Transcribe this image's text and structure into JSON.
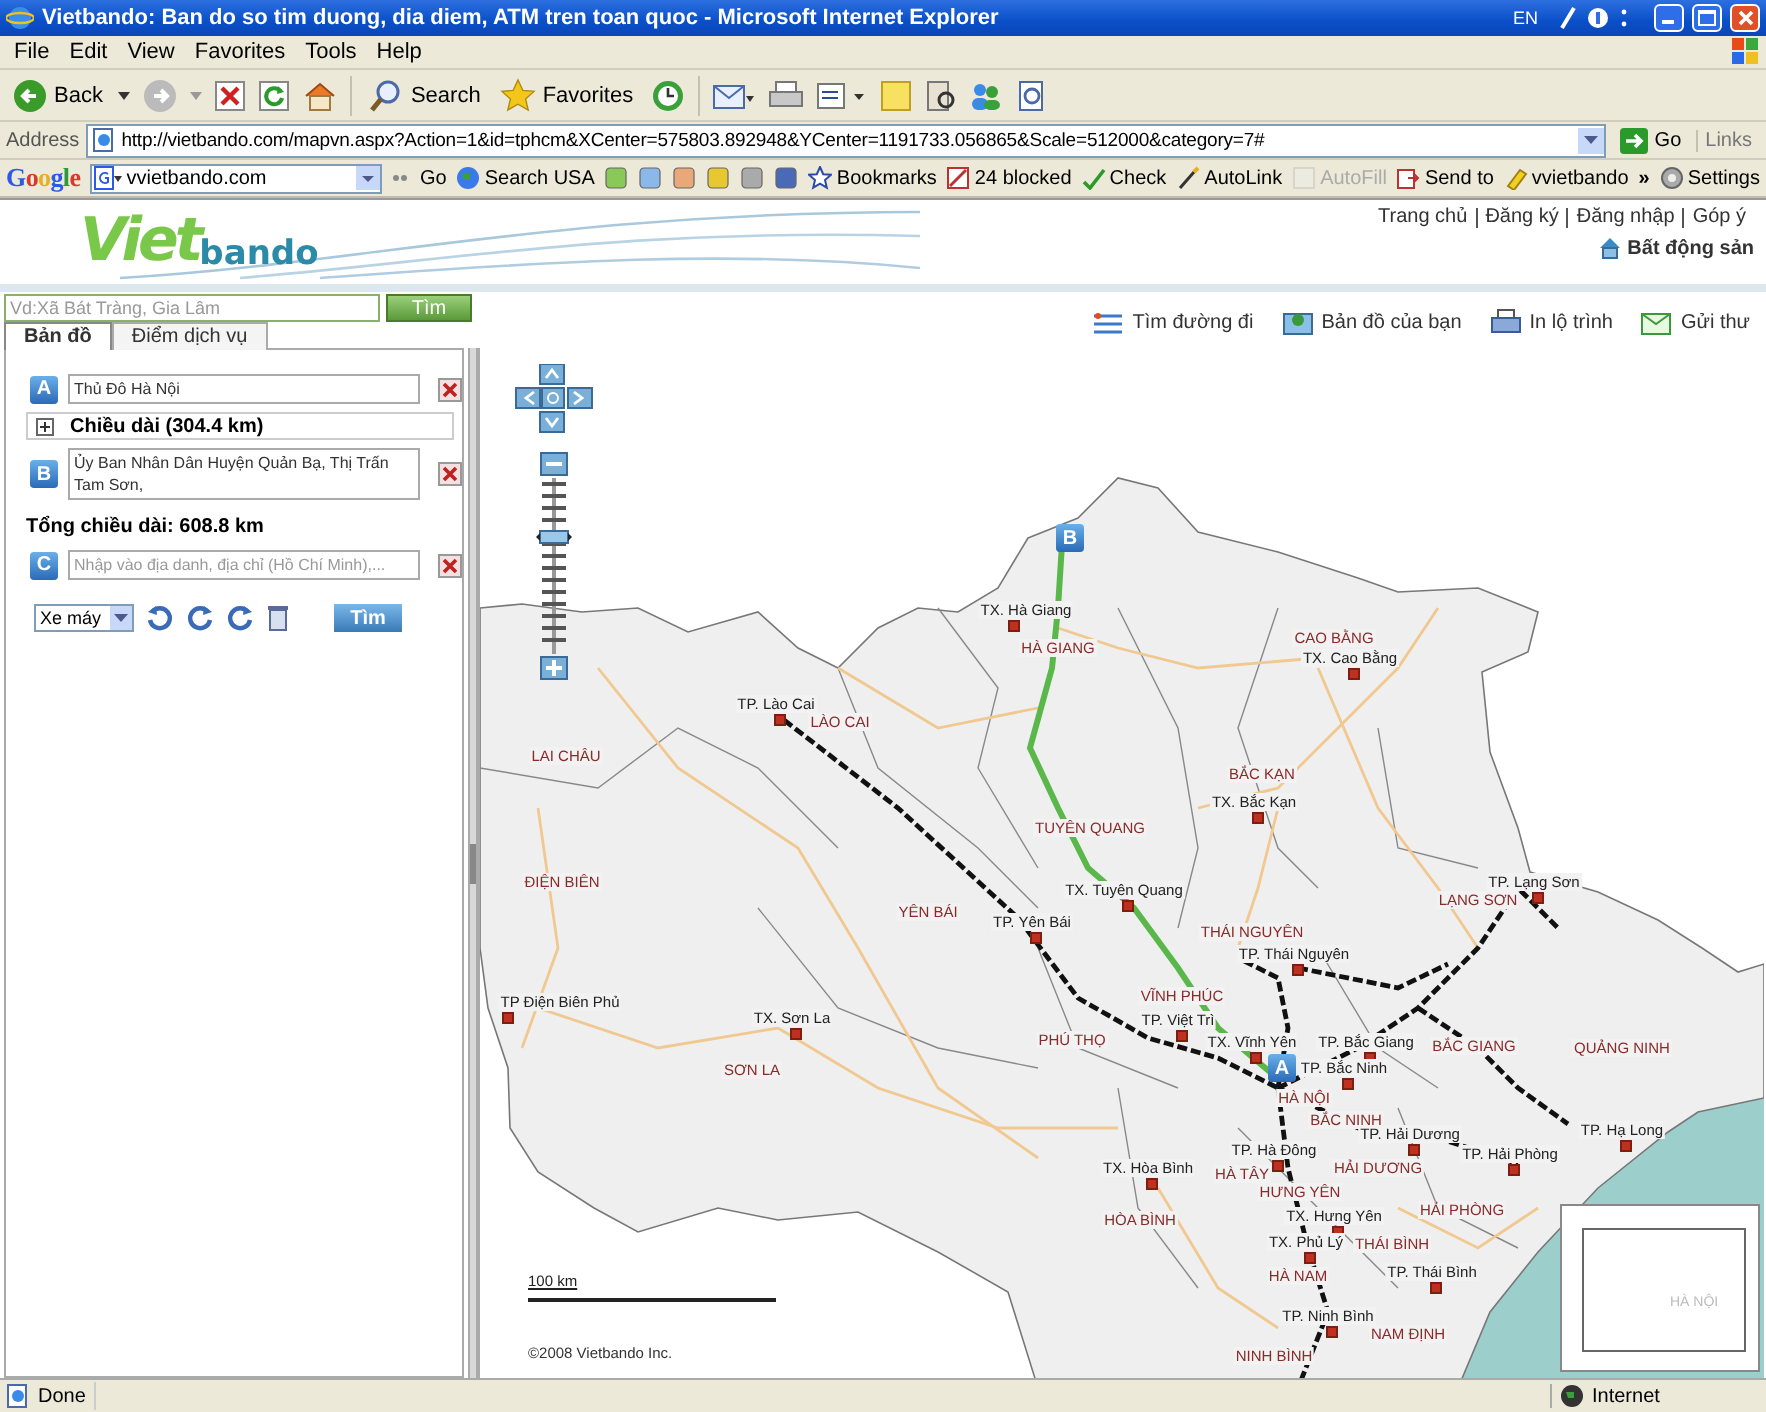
{
  "window": {
    "title": "Vietbando: Ban do so tim duong, dia diem, ATM tren toan quoc - Microsoft Internet Explorer",
    "language": "EN"
  },
  "menu": [
    "File",
    "Edit",
    "View",
    "Favorites",
    "Tools",
    "Help"
  ],
  "toolbar": [
    {
      "label": "Back",
      "kind": "back"
    },
    {
      "label": "Search",
      "kind": "search"
    },
    {
      "label": "Favorites",
      "kind": "favorites"
    }
  ],
  "address_bar": {
    "label": "Address",
    "url": "http://vietbando.com/mapvn.aspx?Action=1&id=tphcm&XCenter=575803.892948&YCenter=1191733.056865&Scale=512000&category=7#",
    "go": "Go",
    "links": "Links"
  },
  "google_bar": {
    "logo": "Google",
    "query": "vvietbando.com",
    "overflow": "»",
    "items": [
      {
        "label": "Go",
        "disabled": false
      },
      {
        "label": "Search USA",
        "disabled": false
      },
      {
        "label": "Bookmarks",
        "disabled": false
      },
      {
        "label": "24 blocked",
        "disabled": false
      },
      {
        "label": "Check",
        "disabled": false
      },
      {
        "label": "AutoLink",
        "disabled": false
      },
      {
        "label": "AutoFill",
        "disabled": true
      },
      {
        "label": "Send to",
        "disabled": false
      },
      {
        "label": "vvietbando",
        "disabled": false
      },
      {
        "label": "Settings",
        "disabled": false
      }
    ]
  },
  "site": {
    "logo_part_1": "Viet",
    "logo_part_2": "bando",
    "top_links": [
      "Trang chủ",
      "Đăng ký",
      "Đăng nhập",
      "Góp ý"
    ],
    "real_estate": "Bất động sản"
  },
  "search": {
    "placeholder": "Vd:Xã Bát Tràng, Gia Lâm",
    "button": "Tìm"
  },
  "tabs": [
    {
      "label": "Bản đồ",
      "selected": true
    },
    {
      "label": "Điểm dịch vụ",
      "selected": false
    }
  ],
  "map_tools": [
    {
      "label": "Tìm đường đi",
      "kind": "route"
    },
    {
      "label": "Bản đồ của bạn",
      "kind": "mymap"
    },
    {
      "label": "In lộ trình",
      "kind": "print"
    },
    {
      "label": "Gửi thư",
      "kind": "mail"
    }
  ],
  "route": {
    "items": [
      {
        "kind": "stop",
        "marker": "A",
        "value": "Thủ Đô Hà Nội"
      },
      {
        "kind": "segment",
        "label": "Chiều dài (304.4 km)",
        "expanded": false
      },
      {
        "kind": "stop",
        "marker": "B",
        "value": "Ủy Ban Nhân Dân Huyện Quản Bạ, Thị Trấn Tam Sơn,"
      },
      {
        "kind": "total",
        "label": "Tổng chiều dài: 608.8 km"
      },
      {
        "kind": "stop",
        "marker": "C",
        "placeholder": "Nhập vào địa danh, địa chỉ (Hồ Chí Minh),..."
      }
    ],
    "vehicle": "Xe máy",
    "button": "Tìm"
  },
  "map": {
    "zoom": {
      "level": 0.68
    },
    "provinces": [
      "HÀ GIANG",
      "CAO BẰNG",
      "LÀO CAI",
      "LAI CHÂU",
      "BẮC KẠN",
      "TUYÊN QUANG",
      "ĐIỆN BIÊN",
      "YÊN BÁI",
      "THÁI NGUYÊN",
      "LẠNG SƠN",
      "VĨNH PHÚC",
      "PHÚ THỌ",
      "SƠN LA",
      "BẮC GIANG",
      "QUẢNG NINH",
      "HÀ NỘI",
      "BẮC NINH",
      "HÀ TÂY",
      "HẢI DƯƠNG",
      "HÒA BÌNH",
      "HƯNG YÊN",
      "HẢI PHÒNG",
      "THÁI BÌNH",
      "HÀ NAM",
      "NAM ĐỊNH",
      "NINH BÌNH"
    ],
    "cities": [
      "TX. Hà Giang",
      "TX. Cao Bằng",
      "TP. Lào Cai",
      "TX. Bắc Kạn",
      "TX. Tuyên Quang",
      "TP. Lạng Sơn",
      "TP. Yên Bái",
      "TP. Thái Nguyên",
      "TP Điện Biên Phủ",
      "TX. Sơn La",
      "TP. Việt Trì",
      "TX. Vĩnh Yên",
      "TP. Bắc Giang",
      "TP. Bắc Ninh",
      "TP. Hạ Long",
      "TP. Hà Đông",
      "TP. Hải Dương",
      "TP. Hải Phòng",
      "TX. Hòa Bình",
      "TX. Hưng Yên",
      "TX. Phủ Lý",
      "TP. Thái Bình",
      "TP. Ninh Bình"
    ],
    "markers": [
      "A",
      "B"
    ],
    "scale": "100 km",
    "copyright": "©2008 Vietbando Inc.",
    "overview_label": "HÀ NỘI"
  },
  "status_bar": {
    "text": "Done",
    "zone": "Internet"
  }
}
